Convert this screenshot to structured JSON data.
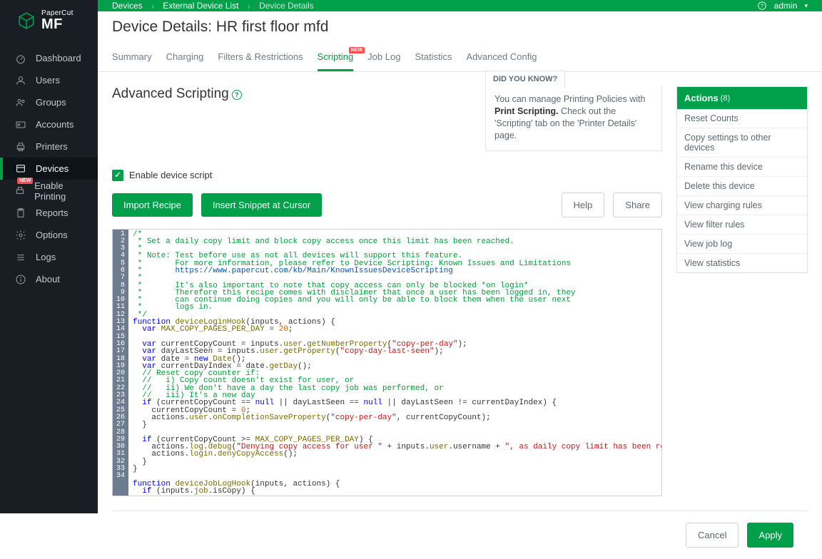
{
  "brand": {
    "top": "PaperCut",
    "bottom": "MF"
  },
  "nav": [
    {
      "label": "Dashboard"
    },
    {
      "label": "Users"
    },
    {
      "label": "Groups"
    },
    {
      "label": "Accounts"
    },
    {
      "label": "Printers"
    },
    {
      "label": "Devices"
    },
    {
      "label": "Enable Printing"
    },
    {
      "label": "Reports"
    },
    {
      "label": "Options"
    },
    {
      "label": "Logs"
    },
    {
      "label": "About"
    }
  ],
  "breadcrumb": {
    "root": "Devices",
    "mid": "External Device List",
    "current": "Device Details",
    "admin": "admin"
  },
  "page_title": "Device Details: HR first floor mfd",
  "tabs": [
    {
      "label": "Summary"
    },
    {
      "label": "Charging"
    },
    {
      "label": "Filters & Restrictions"
    },
    {
      "label": "Scripting",
      "new": true
    },
    {
      "label": "Job Log"
    },
    {
      "label": "Statistics"
    },
    {
      "label": "Advanced Config"
    }
  ],
  "section_title": "Advanced Scripting",
  "didyou": {
    "title": "DID YOU KNOW?",
    "prefix": "You can manage Printing Policies with ",
    "bold": "Print Scripting.",
    "suffix": " Check out the 'Scripting' tab on the 'Printer Details' page."
  },
  "enable_label": "Enable device script",
  "buttons": {
    "import": "Import Recipe",
    "insert": "Insert Snippet at Cursor",
    "help": "Help",
    "share": "Share"
  },
  "code_lines": 34,
  "code": {
    "l2": " * Set a daily copy limit and block copy access once this limit has been reached.",
    "l4": " * Note: Test before use as not all devices will support this feature.",
    "l5": " *       For more information, please refer to Device Scripting: Known Issues and Limitations",
    "l6_url": "https://www.papercut.com/kb/Main/KnownIssuesDeviceScripting",
    "l8": " *       It's also important to note that copy access can only be blocked *on login*",
    "l9": " *       Therefore this recipe comes with disclaimer that once a user has been logged in, they",
    "l10": " *       can continue doing copies and you will only be able to block them when the user next",
    "l11": " *       logs in.",
    "fn1_params": "(inputs, actions)",
    "const_name": "MAX_COPY_PAGES_PER_DAY",
    "const_val": "20",
    "str_copyperday": "\"copy-per-day\"",
    "str_daylast": "\"copy-day-last-seen\"",
    "c19": "// Reset copy counter if:",
    "c20": "//   i) Copy count doesn't exist for user, or",
    "c21": "//   ii) We don't have a day the last copy job was performed, or",
    "c22": "//   iii) It's a new day",
    "deny_a": "\"Denying copy access for user \"",
    "deny_b": "\", as daily copy limit has been reached\""
  },
  "actions": {
    "header": "Actions",
    "count": "(8)",
    "items": [
      "Reset Counts",
      "Copy settings to other devices",
      "Rename this device",
      "Delete this device",
      "View charging rules",
      "View filter rules",
      "View job log",
      "View statistics"
    ]
  },
  "footer": {
    "cancel": "Cancel",
    "apply": "Apply"
  }
}
